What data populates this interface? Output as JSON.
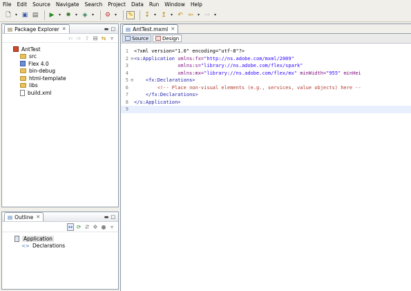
{
  "menu": [
    "File",
    "Edit",
    "Source",
    "Navigate",
    "Search",
    "Project",
    "Data",
    "Run",
    "Window",
    "Help"
  ],
  "toolbar_icons": [
    "new-icon",
    "save-icon",
    "print-icon",
    "run-icon",
    "debug-icon",
    "profile-icon",
    "external-tools-icon",
    "open-perspective-icon",
    "next-annotation-icon",
    "prev-annotation-icon",
    "back-icon",
    "forward-icon"
  ],
  "package_explorer": {
    "title": "Package Explorer",
    "tree": [
      {
        "label": "AntTest",
        "icon": "project-icon"
      },
      {
        "label": "src",
        "icon": "folder-icon"
      },
      {
        "label": "Flex 4.0",
        "icon": "library-icon"
      },
      {
        "label": "bin-debug",
        "icon": "folder-icon"
      },
      {
        "label": "html-template",
        "icon": "folder-icon"
      },
      {
        "label": "libs",
        "icon": "folder-icon"
      },
      {
        "label": "build.xml",
        "icon": "file-icon"
      }
    ]
  },
  "outline": {
    "title": "Outline",
    "tree": [
      {
        "label": "Application",
        "icon": "application-icon"
      },
      {
        "label": "Declarations",
        "icon": "tag-icon"
      }
    ]
  },
  "editor": {
    "tab_title": "AntTest.mxml",
    "source_label": "Source",
    "design_label": "Design",
    "lines": [
      {
        "n": "1",
        "g": "",
        "parts": [
          {
            "t": "<?xml version=\"1.0\" encoding=\"utf-8\"?>",
            "c": "pi"
          }
        ]
      },
      {
        "n": "2",
        "g": "⊖",
        "parts": [
          {
            "t": "<s:Application ",
            "c": "tag"
          },
          {
            "t": "xmlns:fx=",
            "c": "attr"
          },
          {
            "t": "\"http://ns.adobe.com/mxml/2009\"",
            "c": "val"
          }
        ]
      },
      {
        "n": "3",
        "g": "",
        "parts": [
          {
            "t": "               ",
            "c": ""
          },
          {
            "t": "xmlns:s=",
            "c": "attr"
          },
          {
            "t": "\"library://ns.adobe.com/flex/spark\"",
            "c": "val"
          }
        ]
      },
      {
        "n": "4",
        "g": "",
        "parts": [
          {
            "t": "               ",
            "c": ""
          },
          {
            "t": "xmlns:mx=",
            "c": "attr"
          },
          {
            "t": "\"library://ns.adobe.com/flex/mx\" ",
            "c": "val"
          },
          {
            "t": "minWidth=",
            "c": "attr"
          },
          {
            "t": "\"955\" ",
            "c": "val"
          },
          {
            "t": "minHei",
            "c": "attr"
          }
        ]
      },
      {
        "n": "5",
        "g": "⊖",
        "parts": [
          {
            "t": "    <fx:Declarations>",
            "c": "tag"
          }
        ]
      },
      {
        "n": "6",
        "g": "",
        "parts": [
          {
            "t": "        <!-- Place non-visual elements (e.g., services, value objects) here --",
            "c": "cmt"
          }
        ]
      },
      {
        "n": "7",
        "g": "",
        "parts": [
          {
            "t": "    </fx:Declarations>",
            "c": "tag"
          }
        ]
      },
      {
        "n": "8",
        "g": "",
        "parts": [
          {
            "t": "</s:Application>",
            "c": "tag"
          }
        ]
      },
      {
        "n": "9",
        "g": "",
        "parts": [
          {
            "t": "",
            "c": ""
          }
        ]
      }
    ]
  }
}
